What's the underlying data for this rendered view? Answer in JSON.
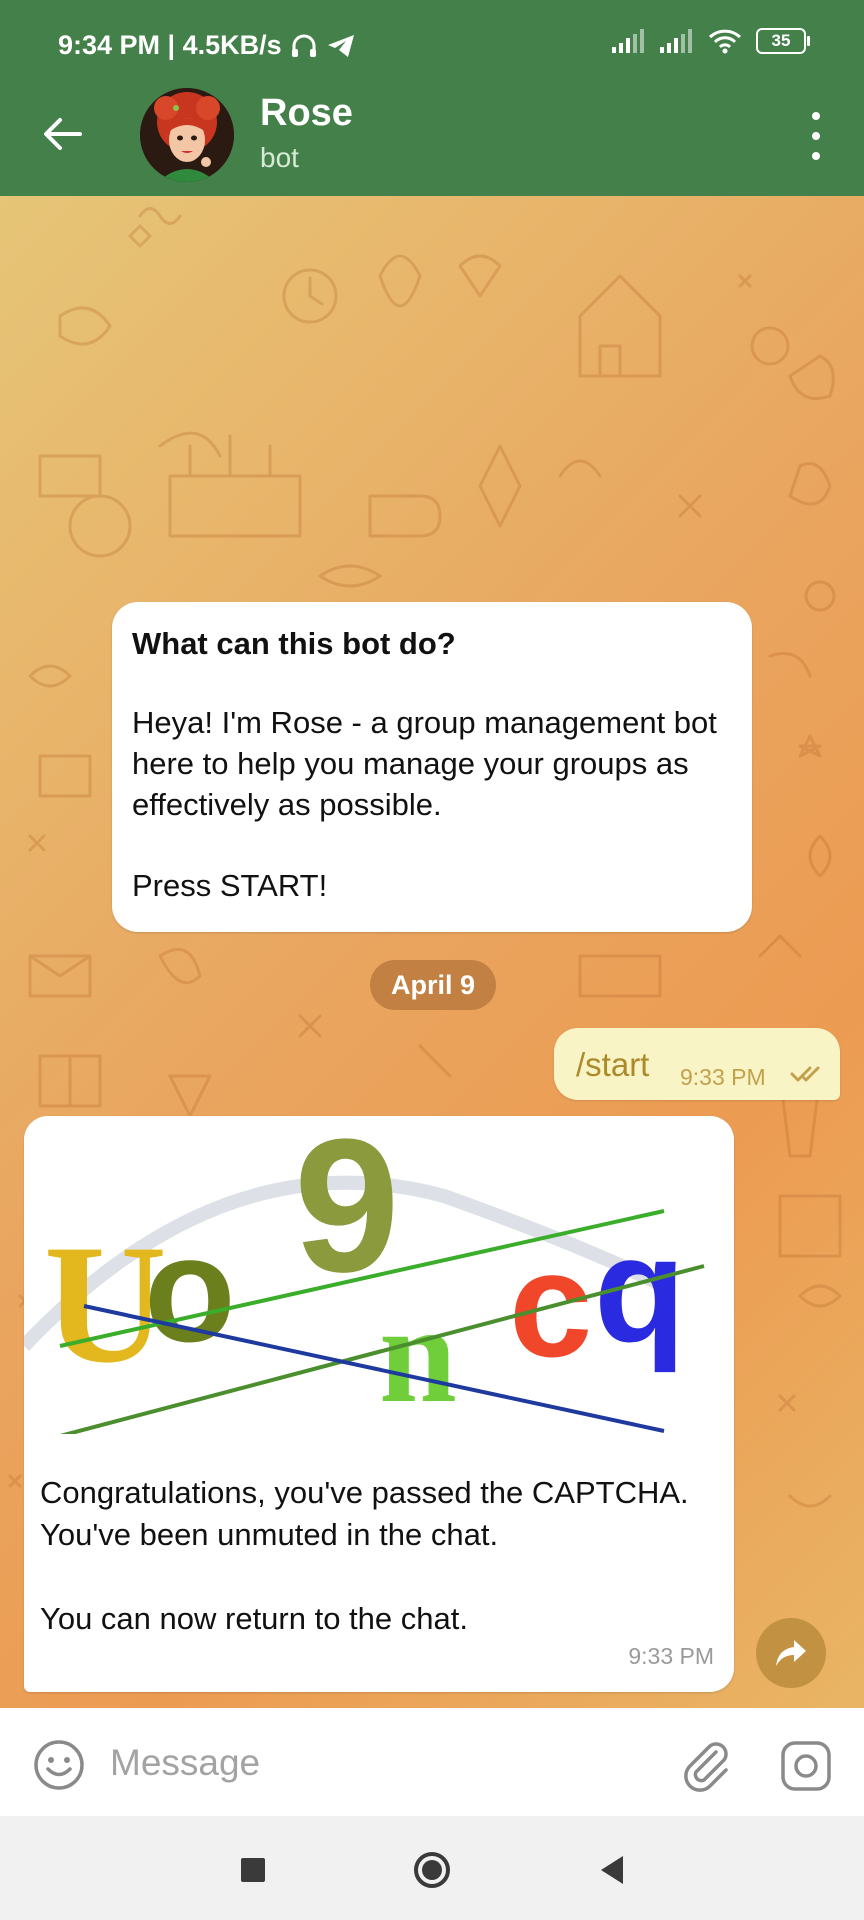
{
  "status_bar": {
    "time_speed": "9:34 PM | 4.5KB/s",
    "battery": "35"
  },
  "header": {
    "title": "Rose",
    "subtitle": "bot"
  },
  "bot_info": {
    "title": "What can this bot do?",
    "body": "Heya! I'm Rose - a group management bot here to help you manage your groups as effectively as possible.",
    "cta": "Press START!"
  },
  "date_chip": "April 9",
  "messages": {
    "outgoing": {
      "text": "/start",
      "time": "9:33 PM"
    },
    "incoming": {
      "captcha_letters": [
        "U",
        "o",
        "9",
        "n",
        "c",
        "q"
      ],
      "text_1": "Congratulations, you've passed the CAPTCHA. You've been unmuted in the chat.",
      "text_2": "You can now return to the chat.",
      "time": "9:33 PM"
    }
  },
  "composer": {
    "placeholder": "Message",
    "value": ""
  },
  "colors": {
    "header": "#44804a",
    "outgoing_bubble": "#f9f4c6",
    "incoming_bubble": "#ffffff"
  }
}
